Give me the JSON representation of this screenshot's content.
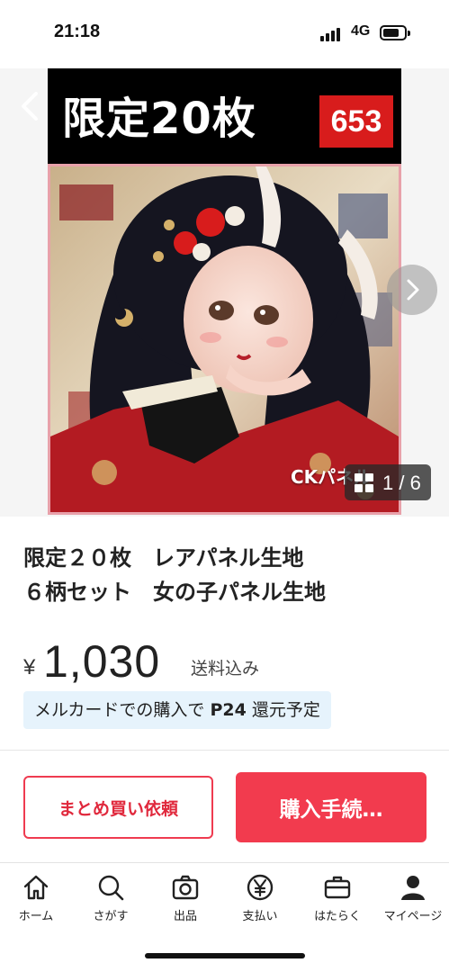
{
  "status_bar": {
    "time": "21:18",
    "network": "4G"
  },
  "hero": {
    "banner_text": "限定20枚",
    "banner_badge": "653",
    "watermark": "CKパネル",
    "counter": "1 / 6"
  },
  "product": {
    "title": "限定２０枚　レアパネル生地\n６柄セット　女の子パネル生地",
    "currency": "¥",
    "price": "1,030",
    "shipping": "送料込み",
    "promo_prefix": "メルカードでの購入で ",
    "promo_points": "P24",
    "promo_suffix": " 還元予定"
  },
  "actions": {
    "bulk_label": "まとめ買い依頼",
    "buy_label": "購入手続…"
  },
  "bottom_nav": {
    "items": [
      {
        "label": "ホーム",
        "icon": "home-icon"
      },
      {
        "label": "さがす",
        "icon": "search-icon"
      },
      {
        "label": "出品",
        "icon": "camera-icon"
      },
      {
        "label": "支払い",
        "icon": "yen-icon"
      },
      {
        "label": "はたらく",
        "icon": "briefcase-icon"
      },
      {
        "label": "マイページ",
        "icon": "person-icon"
      }
    ]
  },
  "colors": {
    "accent": "#f23b4e",
    "badge_red": "#d81c1c",
    "promo_bg": "#e6f3fc"
  }
}
